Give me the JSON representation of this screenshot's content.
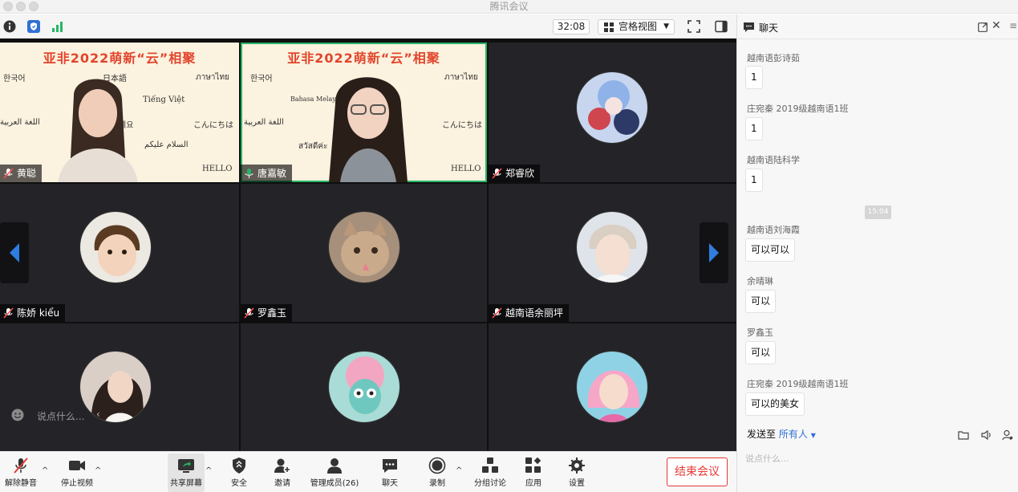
{
  "window": {
    "title": "腾讯会议"
  },
  "toolbar": {
    "timer": "32:08",
    "view_label": "宫格视图"
  },
  "tiles": [
    {
      "name": "黄聪"
    },
    {
      "name": "唐嘉敏"
    },
    {
      "name": "郑睿欣"
    },
    {
      "name": "陈娇 kiểu"
    },
    {
      "name": "罗鑫玉"
    },
    {
      "name": "越南语余丽坪"
    }
  ],
  "slide": {
    "title": "亚非2022萌新“云”相聚",
    "words": [
      "한국어",
      "日本語",
      "ภาษาไทย",
      "Tiếng Việt",
      "Bahasa Melayu",
      "اللغة العربية",
      "세요",
      "こんにちは",
      "السلام عليكم",
      "สวัสดีค่ะ",
      "HELLO"
    ]
  },
  "inline_chat": {
    "placeholder": "说点什么..."
  },
  "controls": {
    "unmute": "解除静音",
    "stop_video": "停止视频",
    "share_screen": "共享屏幕",
    "security": "安全",
    "invite": "邀请",
    "manage_members": "管理成员(26)",
    "chat": "聊天",
    "record": "录制",
    "breakout": "分组讨论",
    "apps": "应用",
    "settings": "设置",
    "end_meeting": "结束会议"
  },
  "chat": {
    "title": "聊天",
    "messages": [
      {
        "sender": "越南语彭诗茹",
        "text": "1"
      },
      {
        "sender": "庄宛秦 2019级越南语1班",
        "text": "1"
      },
      {
        "sender": "越南语陆科学",
        "text": "1"
      },
      {
        "sender": "越南语刘海霞",
        "text": "可以可以"
      },
      {
        "sender": "余晴琳",
        "text": "可以"
      },
      {
        "sender": "罗鑫玉",
        "text": "可以"
      },
      {
        "sender": "庄宛秦 2019级越南语1班",
        "text": "可以的美女"
      }
    ],
    "timestamp": "15:04",
    "send_to_label": "发送至",
    "send_to_target": "所有人",
    "input_placeholder": "说点什么..."
  },
  "colors": {
    "active_speaker": "#27b567",
    "end_button": "#e53935",
    "nav_arrow": "#2f7de1",
    "link_blue": "#2f6fd6",
    "slide_title": "#e2452c"
  }
}
